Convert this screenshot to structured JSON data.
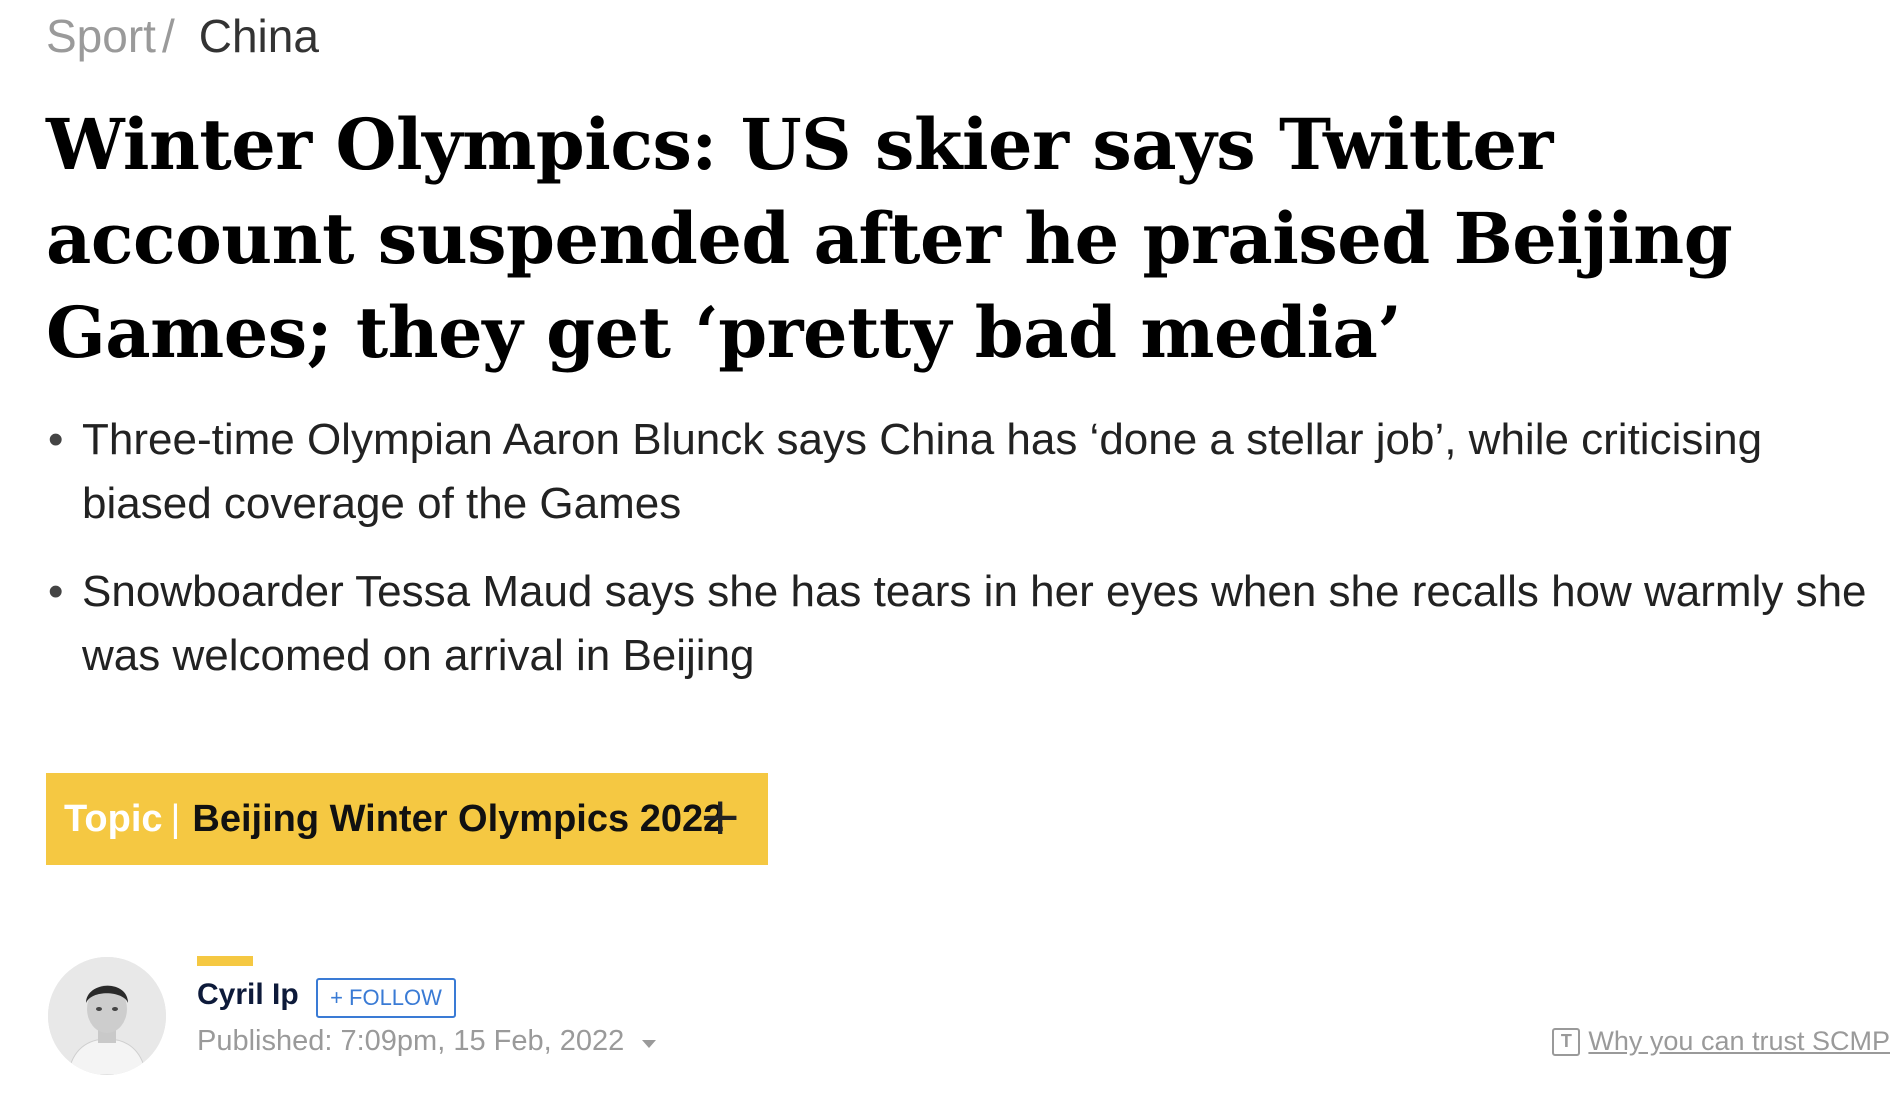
{
  "breadcrumb": {
    "parent": "Sport",
    "separator": "/",
    "current": "China"
  },
  "headline": "Winter Olympics: US skier says Twitter account suspended after he praised Beijing Games; they get ‘pretty bad media’",
  "summary": [
    "Three-time Olympian Aaron Blunck says China has ‘done a stellar job’, while criticising biased coverage of the Games",
    "Snowboarder Tessa Maud says she has tears in her eyes when she recalls how warmly she was welcomed on arrival in Beijing"
  ],
  "topic": {
    "label": "Topic",
    "separator": "|",
    "name": "Beijing Winter Olympics 2022",
    "expand_icon": "plus-icon",
    "color": "#f5c842"
  },
  "author": {
    "name": "Cyril Ip",
    "follow_label": "+ FOLLOW",
    "published": "Published: 7:09pm, 15 Feb, 2022"
  },
  "trust": {
    "icon": "trust-icon",
    "label": "Why you can trust SCMP"
  }
}
